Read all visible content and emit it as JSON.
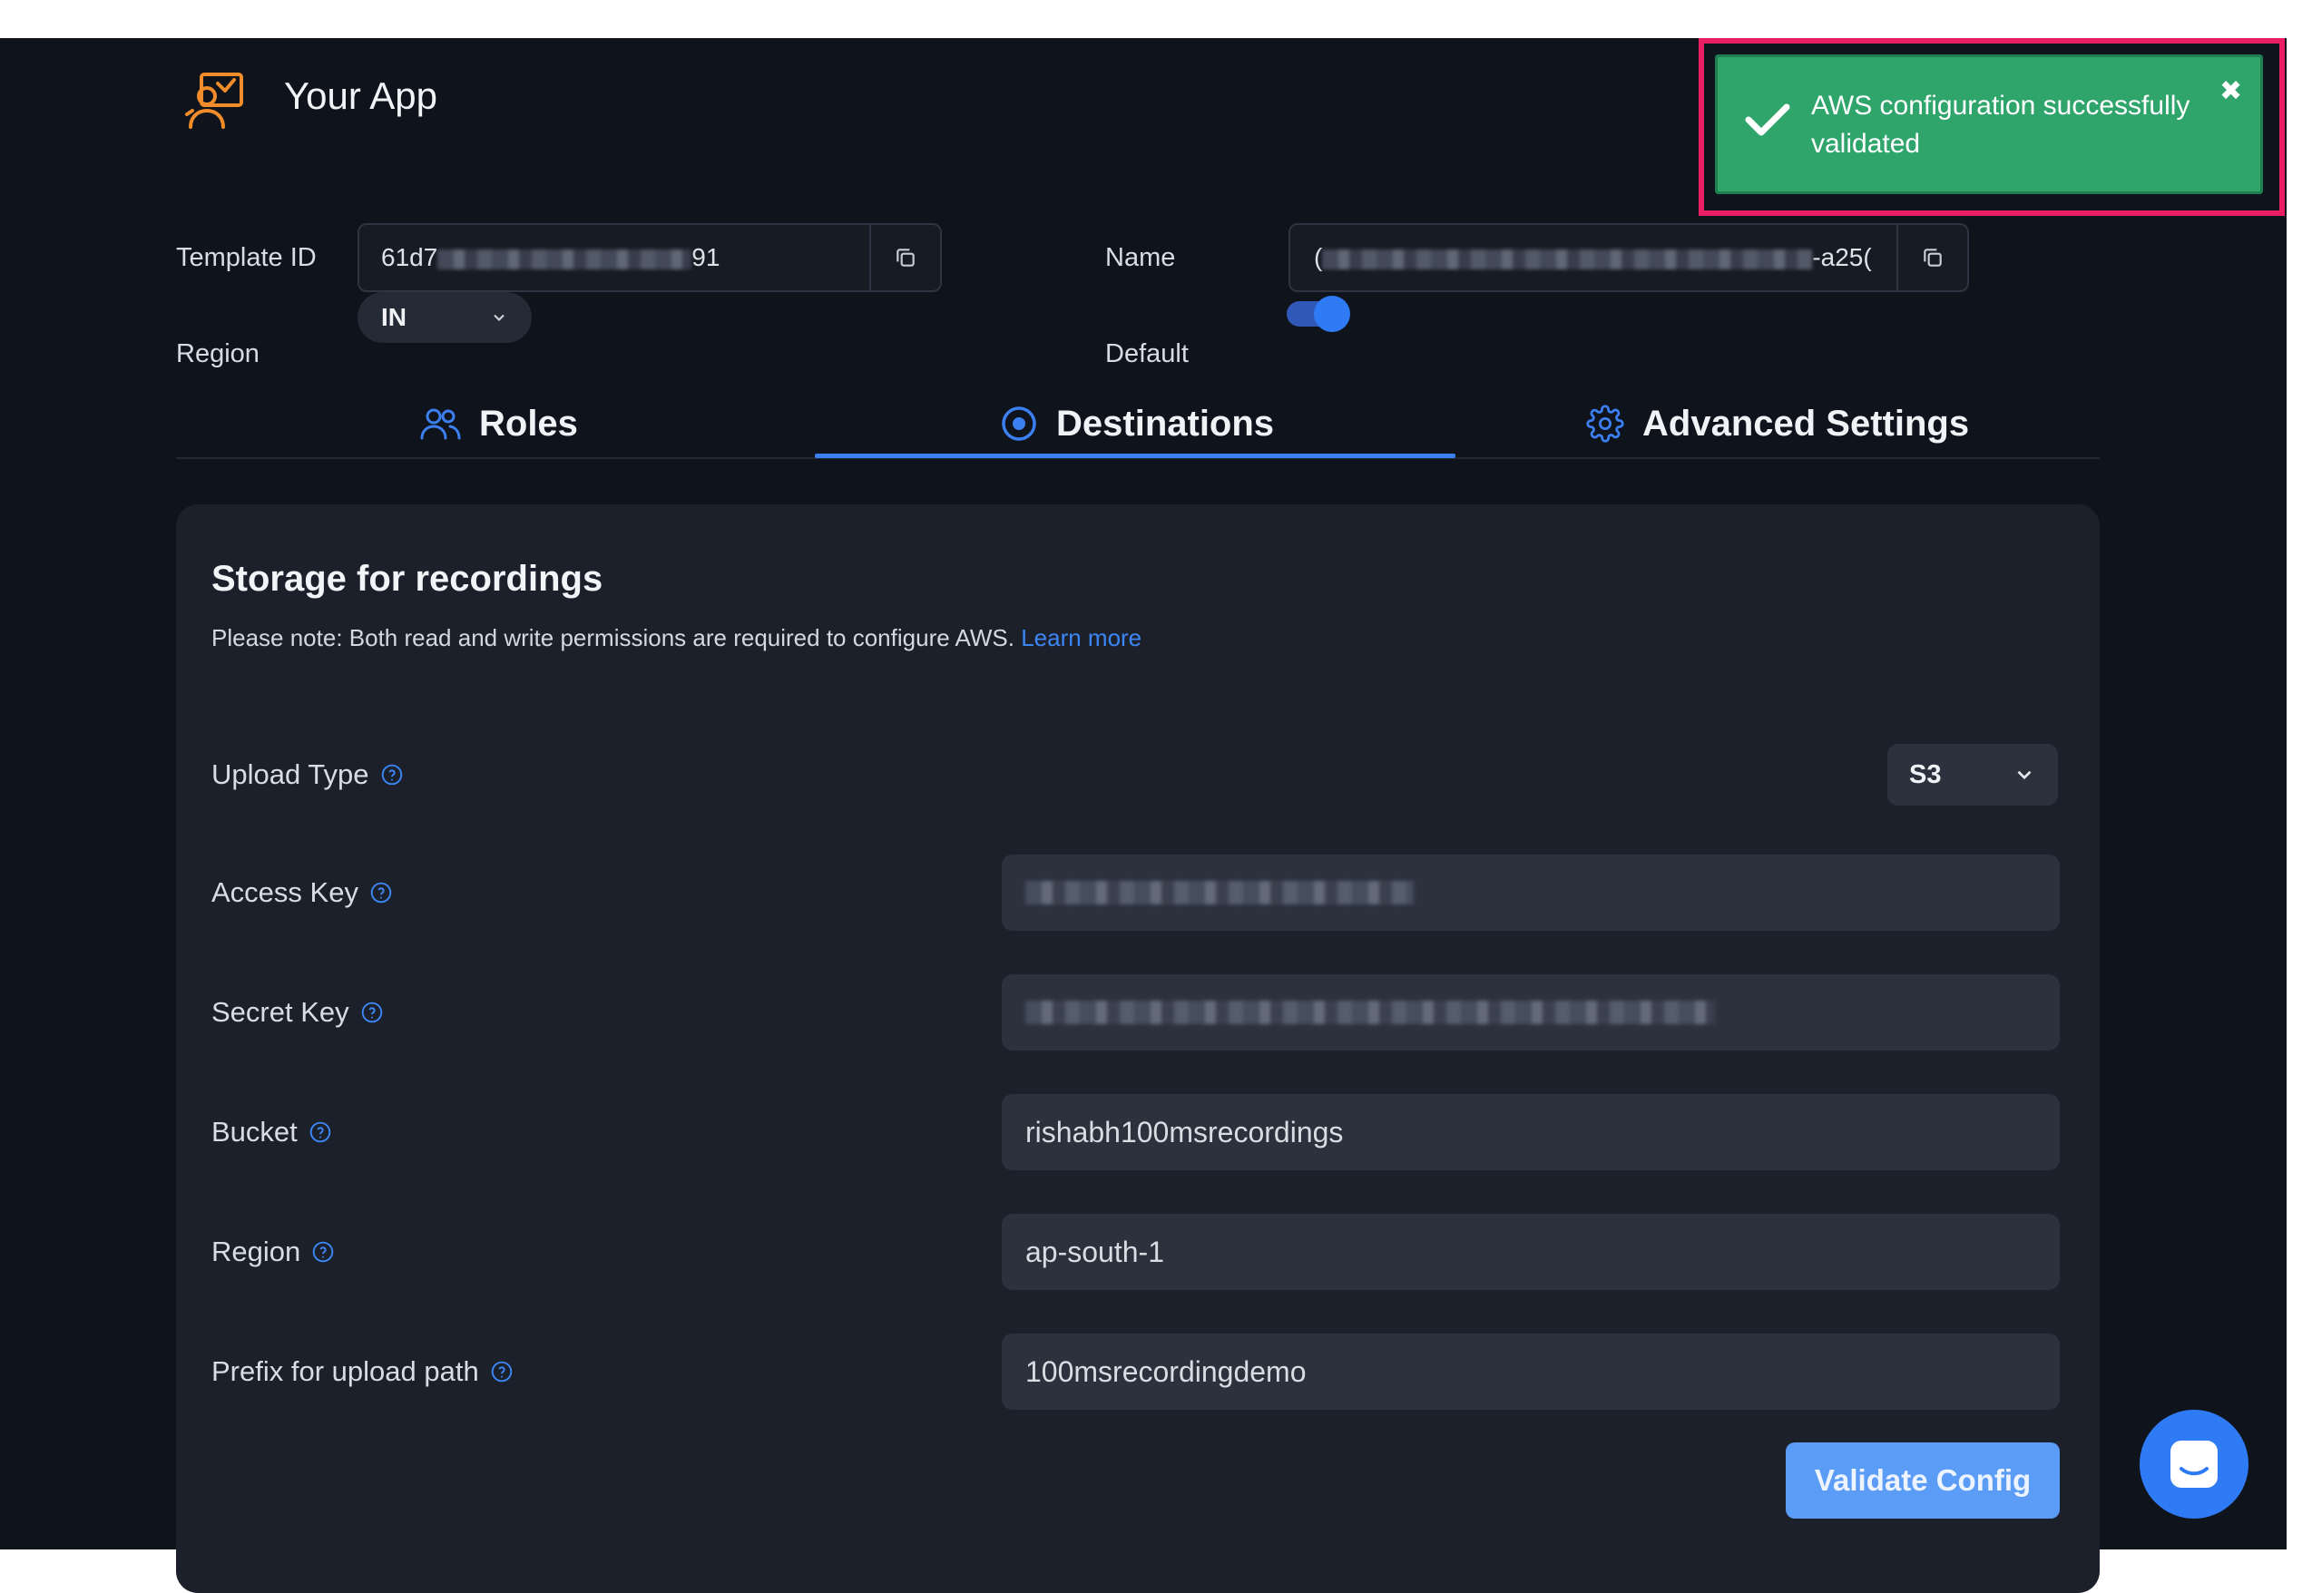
{
  "header": {
    "app_title": "Your App"
  },
  "template": {
    "template_id_label": "Template ID",
    "template_id_prefix": "61d7",
    "template_id_suffix": "91",
    "name_label": "Name",
    "name_prefix": "(",
    "name_suffix": "-a25(",
    "region_label": "Region",
    "region_value": "IN",
    "default_label": "Default",
    "default_on": true
  },
  "tabs": [
    {
      "label": "Roles",
      "icon": "users-icon"
    },
    {
      "label": "Destinations",
      "icon": "radio-target-icon",
      "active": true
    },
    {
      "label": "Advanced Settings",
      "icon": "gear-icon"
    }
  ],
  "storage": {
    "title": "Storage for recordings",
    "note": "Please note: Both read and write permissions are required to configure AWS.",
    "learn_more": "Learn more",
    "upload_type_label": "Upload Type",
    "upload_type_value": "S3",
    "access_key_label": "Access Key",
    "secret_key_label": "Secret Key",
    "bucket_label": "Bucket",
    "bucket_value": "rishabh100msrecordings",
    "region_label": "Region",
    "region_value": "ap-south-1",
    "prefix_label": "Prefix for upload path",
    "prefix_value": "100msrecordingdemo",
    "validate_button": "Validate Config"
  },
  "toast": {
    "message": "AWS configuration successfully validated",
    "close_glyph": "✖"
  },
  "colors": {
    "background": "#0f131b",
    "panel": "#1b202b",
    "accent": "#2f7bf5",
    "toast_green": "#2fa56c",
    "highlight": "#ea1f63"
  }
}
